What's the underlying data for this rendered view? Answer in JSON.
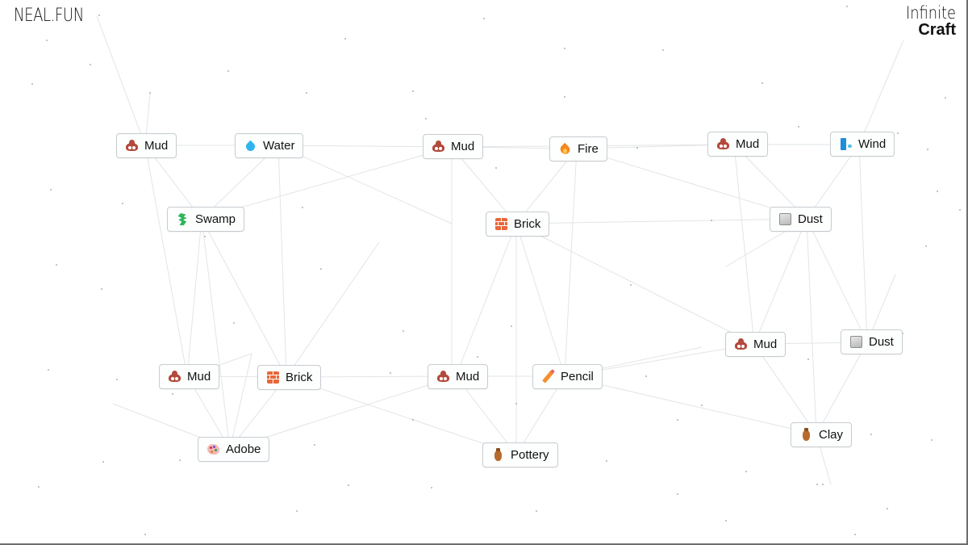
{
  "header": {
    "site_logo": "NEAL.FUN",
    "game_title_line1": "Infinite",
    "game_title_line2": "Craft"
  },
  "colors": {
    "background": "#ffffff",
    "item_border": "#c8ccd0",
    "link_line": "#e3e5e8"
  },
  "items": [
    {
      "id": "mud1",
      "label": "Mud",
      "icon": "pile-of-poo-icon",
      "cls": "ic-mud"
    },
    {
      "id": "water1",
      "label": "Water",
      "icon": "droplet-icon",
      "cls": "ic-water"
    },
    {
      "id": "mud2",
      "label": "Mud",
      "icon": "pile-of-poo-icon",
      "cls": "ic-mud"
    },
    {
      "id": "fire1",
      "label": "Fire",
      "icon": "fire-icon",
      "cls": "ic-fire"
    },
    {
      "id": "mud3",
      "label": "Mud",
      "icon": "pile-of-poo-icon",
      "cls": "ic-mud"
    },
    {
      "id": "wind1",
      "label": "Wind",
      "icon": "wind-icon",
      "cls": "ic-wind"
    },
    {
      "id": "swamp1",
      "label": "Swamp",
      "icon": "swamp-creature-icon",
      "cls": "ic-swamp"
    },
    {
      "id": "brick1",
      "label": "Brick",
      "icon": "brick-icon",
      "cls": "ic-brick"
    },
    {
      "id": "dust1",
      "label": "Dust",
      "icon": "dust-icon",
      "cls": "ic-dust"
    },
    {
      "id": "mud4",
      "label": "Mud",
      "icon": "pile-of-poo-icon",
      "cls": "ic-mud"
    },
    {
      "id": "dust2",
      "label": "Dust",
      "icon": "dust-icon",
      "cls": "ic-dust"
    },
    {
      "id": "mud5",
      "label": "Mud",
      "icon": "pile-of-poo-icon",
      "cls": "ic-mud"
    },
    {
      "id": "brick2",
      "label": "Brick",
      "icon": "brick-icon",
      "cls": "ic-brick"
    },
    {
      "id": "mud6",
      "label": "Mud",
      "icon": "pile-of-poo-icon",
      "cls": "ic-mud"
    },
    {
      "id": "pencil1",
      "label": "Pencil",
      "icon": "pencil-icon",
      "cls": "ic-pencil"
    },
    {
      "id": "clay1",
      "label": "Clay",
      "icon": "amphora-icon",
      "cls": "ic-vase"
    },
    {
      "id": "adobe1",
      "label": "Adobe",
      "icon": "palette-icon",
      "cls": "ic-adobe"
    },
    {
      "id": "pottery1",
      "label": "Pottery",
      "icon": "amphora-icon",
      "cls": "ic-vase"
    }
  ]
}
